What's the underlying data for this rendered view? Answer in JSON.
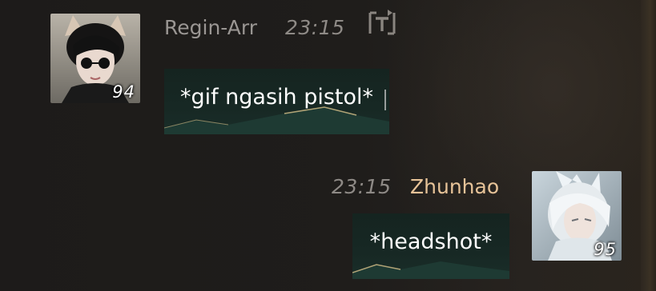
{
  "messages": [
    {
      "sender": "Regin-Arr",
      "time": "23:15",
      "level": "94",
      "text": "*gif ngasih pistol*",
      "side": "left",
      "name_color": "#9a9693"
    },
    {
      "sender": "Zhunhao",
      "time": "23:15",
      "level": "95",
      "text": "*headshot*",
      "side": "right",
      "name_color": "#e7c398"
    }
  ],
  "icons": {
    "translate": "translate-icon"
  },
  "colors": {
    "bubble": "#172824",
    "bubble_accent": "#d7c089",
    "time": "#8e8a86"
  }
}
